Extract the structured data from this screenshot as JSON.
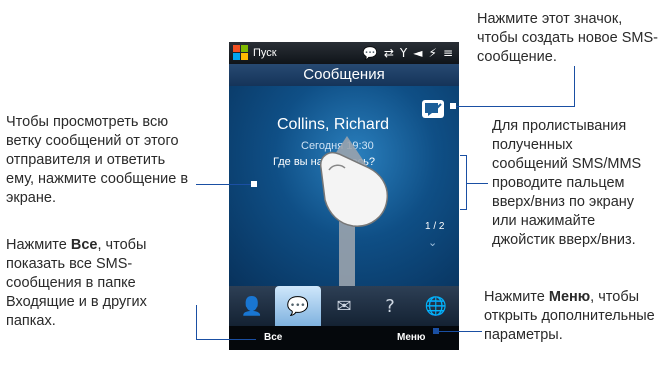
{
  "phone": {
    "status_bar": {
      "start_label": "Пуск",
      "icons": [
        "💬",
        "⇄",
        "Y",
        "◄",
        "⚡",
        "≡"
      ]
    },
    "header_title": "Сообщения",
    "message": {
      "sender": "Collins, Richard",
      "time": "Сегодня 19:30",
      "preview": "Где вы находитесь?"
    },
    "counter": "1 / 2",
    "tabs": [
      "👤",
      "💬",
      "✉",
      "?",
      "🌐"
    ],
    "softkeys": {
      "left": "Все",
      "right": "Меню"
    }
  },
  "annotations": {
    "new_sms": "Нажмите этот значок, чтобы создать новое SMS-сообщение.",
    "view_thread": "Чтобы просмотреть всю ветку сообщений от этого отправителя и ответить ему, нажмите сообщение в экране.",
    "scroll_lines": [
      "Для пролистывания",
      "полученных",
      "сообщений SMS/MMS",
      "проводите пальцем",
      "вверх/вниз по экрану",
      "или нажимайте",
      "джойстик вверх/вниз."
    ],
    "all_pre": "Нажмите ",
    "all_bold": "Все",
    "all_post": ", чтобы показать все SMS-сообщения в папке Входящие и в других папках.",
    "menu_pre": "Нажмите ",
    "menu_bold": "Меню",
    "menu_post": ", чтобы открыть дополнительные параметры."
  }
}
